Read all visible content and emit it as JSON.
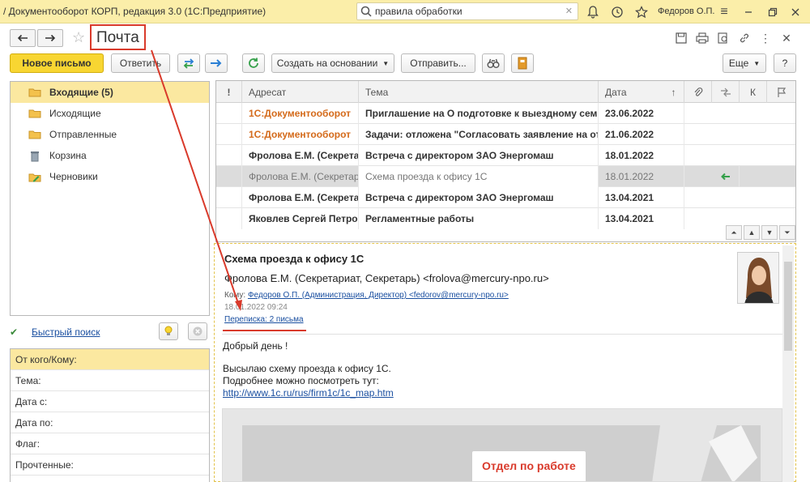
{
  "titlebar": {
    "app_title": "/ Документооборот КОРП, редакция 3.0  (1С:Предприятие)",
    "search_value": "правила обработки",
    "user": "Федоров О.П."
  },
  "header": {
    "title": "Почта"
  },
  "toolbar": {
    "new_mail": "Новое письмо",
    "reply": "Ответить",
    "create_based": "Создать на основании",
    "send": "Отправить...",
    "more": "Еще",
    "help": "?"
  },
  "folders": [
    {
      "label": "Входящие (5)",
      "icon": "folder-icon"
    },
    {
      "label": "Исходящие",
      "icon": "folder-icon"
    },
    {
      "label": "Отправленные",
      "icon": "folder-icon"
    },
    {
      "label": "Корзина",
      "icon": "trash-icon"
    },
    {
      "label": "Черновики",
      "icon": "drafts-icon"
    }
  ],
  "quick_search": {
    "label": "Быстрый поиск"
  },
  "filters": [
    {
      "label": "От кого/Кому:"
    },
    {
      "label": "Тема:"
    },
    {
      "label": "Дата с:"
    },
    {
      "label": "Дата по:"
    },
    {
      "label": "Флаг:"
    },
    {
      "label": "Прочтенные:"
    }
  ],
  "grid": {
    "columns": {
      "importance": "!",
      "addressee": "Адресат",
      "subject": "Тема",
      "date": "Дата",
      "sort": "↑",
      "k": "К"
    },
    "rows": [
      {
        "addressee": "1С:Документооборот",
        "subject": "Приглашение на О подготовке к выездному семинару",
        "date": "23.06.2022"
      },
      {
        "addressee": "1С:Документооборот",
        "subject": "Задачи: отложена \"Согласовать заявление на отпуск\"",
        "date": "21.06.2022"
      },
      {
        "addressee": "Фролова Е.М. (Секретариат, Секретарь)",
        "subject": "Встреча с директором ЗАО Энергомаш",
        "date": "18.01.2022"
      },
      {
        "addressee": "Фролова Е.М. (Секретариат, Секретарь)",
        "subject": "Схема проезда к офису 1С",
        "date": "18.01.2022"
      },
      {
        "addressee": "Фролова Е.М. (Секретариат, Секретарь)",
        "subject": "Встреча с директором ЗАО Энергомаш",
        "date": "13.04.2021"
      },
      {
        "addressee": "Яковлев Сергей Петрович",
        "subject": "Регламентные работы",
        "date": "13.04.2021"
      }
    ]
  },
  "message": {
    "subject": "Схема проезда к офису 1С",
    "from": "Фролова Е.М. (Секретариат, Секретарь) <frolova@mercury-npo.ru>",
    "to_label": "Кому:",
    "to": "Федоров О.П. (Администрация, Директор) <fedorov@mercury-npo.ru>",
    "date": "18.01.2022 09:24",
    "thread": "Переписка: 2 письма",
    "body_greeting": "Добрый день !",
    "body_line1": "Высылаю схему проезда к офису 1С.",
    "body_line2": "Подробнее можно посмотреть тут:",
    "body_link": "http://www.1c.ru/rus/firm1c/1c_map.htm",
    "map_caption": "Отдел по работе"
  },
  "colors": {
    "accent_yellow": "#f8d632",
    "title_bar": "#fbeea9",
    "selection": "#fbe8a0",
    "unread_system": "#d46a1a",
    "annotation_red": "#d93a2b",
    "link": "#1a4fa0"
  }
}
